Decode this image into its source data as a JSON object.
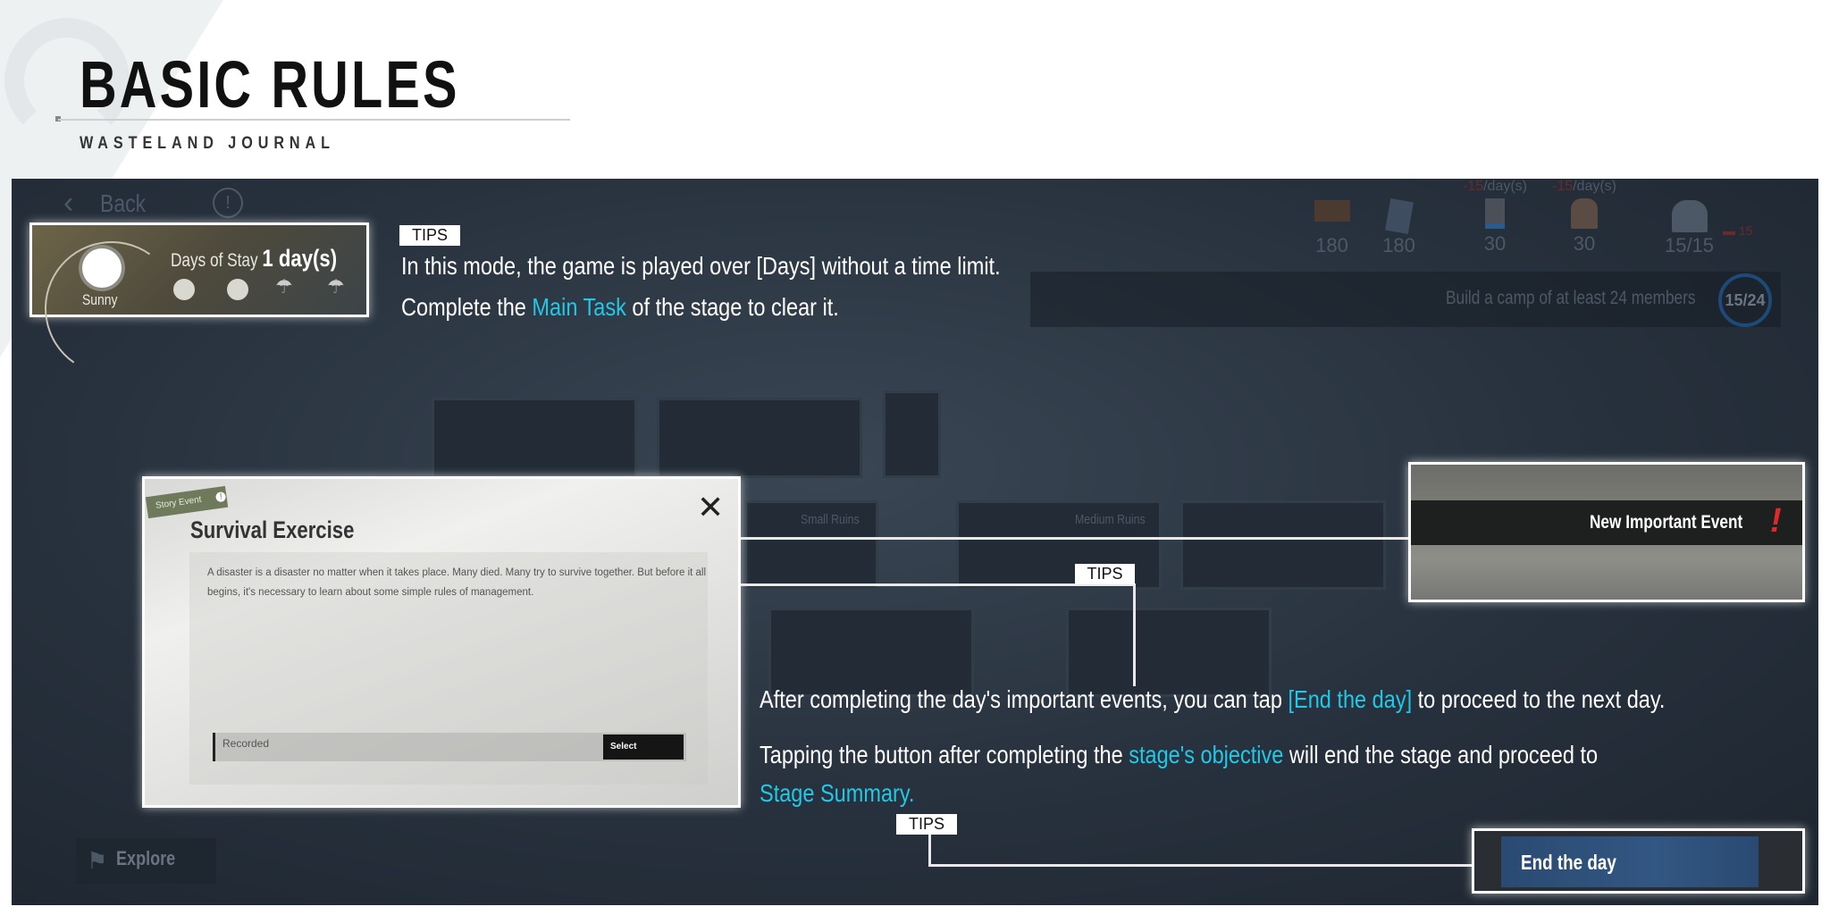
{
  "header": {
    "title": "BASIC RULES",
    "subtitle": "WASTELAND JOURNAL"
  },
  "game": {
    "back_label": "Back",
    "weather": {
      "days_label": "Days of Stay",
      "days_value": "1 day(s)",
      "current": "Sunny"
    },
    "resources": [
      {
        "icon": "wood-icon",
        "value": "180",
        "rate_neg": "",
        "rate": ""
      },
      {
        "icon": "steel-icon",
        "value": "180",
        "rate_neg": "",
        "rate": ""
      },
      {
        "icon": "medicine-icon",
        "value": "30",
        "rate_neg": "-15",
        "rate": "/day(s)"
      },
      {
        "icon": "bread-icon",
        "value": "30",
        "rate_neg": "-15",
        "rate": "/day(s)"
      },
      {
        "icon": "members-icon",
        "value": "15/15",
        "rate_neg": "",
        "rate": ""
      }
    ],
    "bed_count": "15",
    "objective": {
      "text": "Build a camp of at least 24 members",
      "progress": "15/24",
      "progress_fraction": 0.625
    },
    "map": {
      "small_ruins": "Small Ruins",
      "medium_ruins": "Medium Ruins"
    },
    "explore_label": "Explore",
    "dialog": {
      "tag": "Story Event",
      "title": "Survival Exercise",
      "body": "A disaster is a disaster no matter when it takes place. Many died. Many try to survive together. But before it all begins, it's necessary to learn about some simple rules of management.",
      "option": "Recorded",
      "select_label": "Select"
    },
    "new_event_label": "New Important Event",
    "end_day_label": "End the day"
  },
  "tips": {
    "label": "TIPS",
    "tip1": {
      "line1": "In this mode, the game is played over [Days] without a time limit.",
      "line2_a": "Complete the ",
      "line2_hl": "Main Task",
      "line2_b": " of the stage to clear it."
    },
    "tip2": {
      "p1_a": "After completing the day's important events, you can tap ",
      "p1_hl": "[End the day]",
      "p1_b": " to proceed to the next day.",
      "p2_a": "Tapping the button after completing the ",
      "p2_hl": "stage's objective",
      "p2_b": " will end the stage and proceed to",
      "p2_hl2": "Stage Summary."
    }
  },
  "colors": {
    "accent": "#22c8e6",
    "alert": "#e02a2a"
  }
}
